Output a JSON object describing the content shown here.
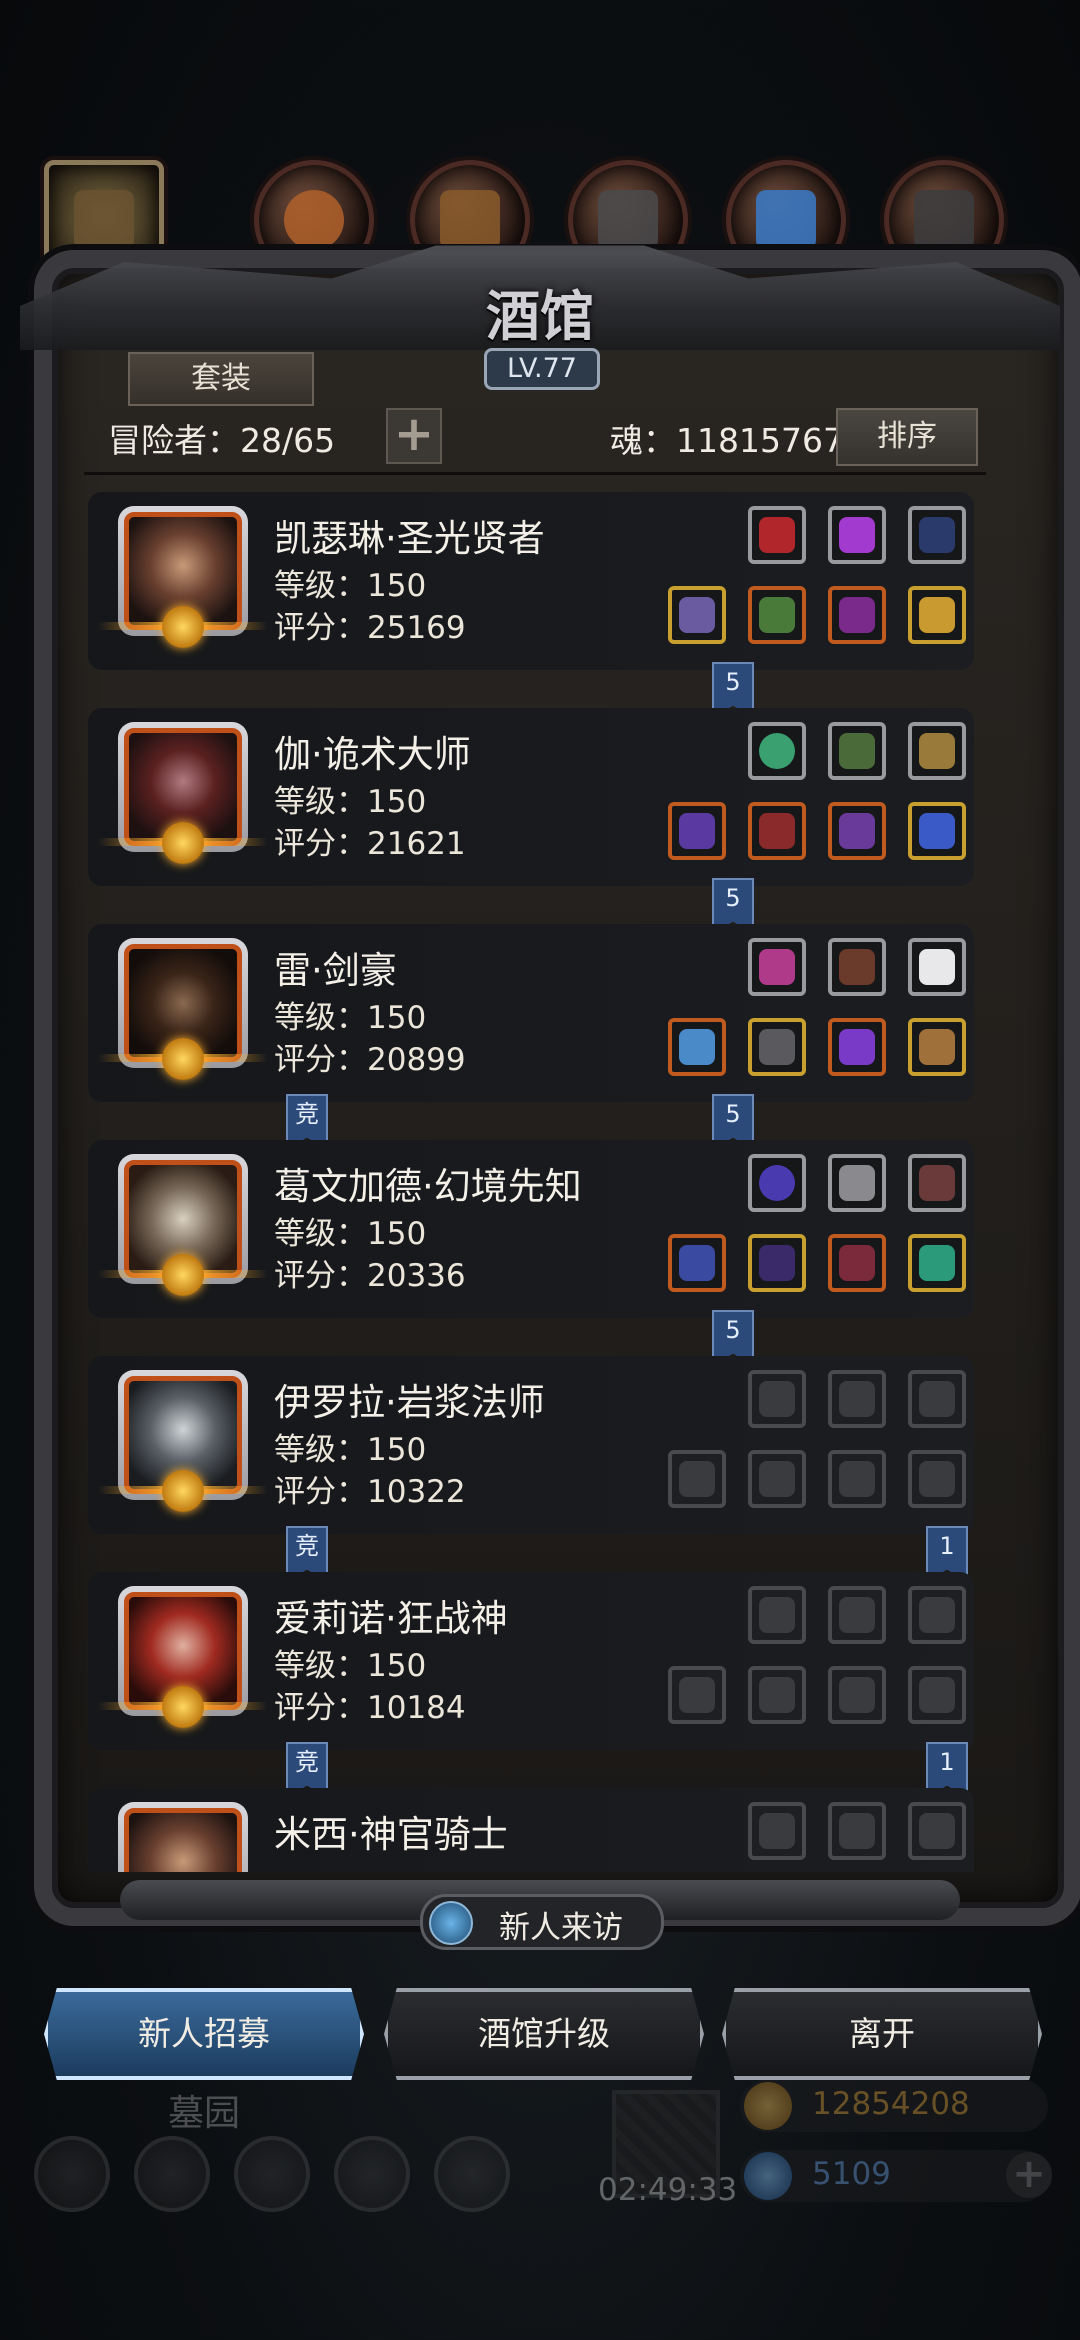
{
  "header": {
    "title": "酒馆",
    "level": "LV.77",
    "set_button": "套装",
    "adventurer_label": "冒险者：28/65",
    "add_button": "+",
    "soul_label": "魂：11815767",
    "sort_button": "排序"
  },
  "heroes": [
    {
      "name": "凯瑟琳·圣光贤者",
      "level": "等级：150",
      "score": "评分：25169",
      "ribbons": [
        "5"
      ]
    },
    {
      "name": "伽·诡术大师",
      "level": "等级：150",
      "score": "评分：21621",
      "ribbons": [
        "5"
      ]
    },
    {
      "name": "雷·剑豪",
      "level": "等级：150",
      "score": "评分：20899",
      "ribbons": [
        "竞",
        "5"
      ]
    },
    {
      "name": "葛文加德·幻境先知",
      "level": "等级：150",
      "score": "评分：20336",
      "ribbons": [
        "5"
      ]
    },
    {
      "name": "伊罗拉·岩浆法师",
      "level": "等级：150",
      "score": "评分：10322",
      "ribbons": [
        "竞",
        "1"
      ]
    },
    {
      "name": "爱莉诺·狂战神",
      "level": "等级：150",
      "score": "评分：10184",
      "ribbons": [
        "竞",
        "1"
      ]
    },
    {
      "name": "米西·神官骑士",
      "level": "",
      "score": "",
      "ribbons": []
    }
  ],
  "colors": {
    "gem_purple": "#a23ad0",
    "gem_green": "#3aa070",
    "gem_red": "#b0262a",
    "gem_gold": "#c89a30",
    "gem_blue": "#3a5ac8",
    "ribbon_blue": "#2b4a7a",
    "active_button": "#3a6a9a"
  },
  "footer": {
    "visit_label": "新人来访",
    "recruit_button": "新人招募",
    "upgrade_button": "酒馆升级",
    "leave_button": "离开"
  },
  "background": {
    "graveyard_label": "墓园",
    "timer": "02:49:33",
    "gold_value": "12854208",
    "gem_value": "5109",
    "add_icon": "+"
  }
}
